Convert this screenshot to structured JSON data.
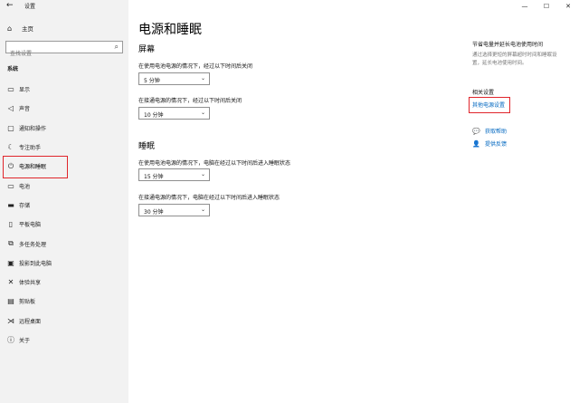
{
  "window": {
    "title": "设置",
    "controls": {
      "minimize": "—",
      "maximize": "☐",
      "close": "✕"
    }
  },
  "sidebar": {
    "home_label": "主页",
    "search_placeholder": "查找设置",
    "section": "系统",
    "items": [
      {
        "label": "显示",
        "icon": "monitor-icon"
      },
      {
        "label": "声音",
        "icon": "speaker-icon"
      },
      {
        "label": "通知和操作",
        "icon": "notification-icon"
      },
      {
        "label": "专注助手",
        "icon": "moon-icon"
      },
      {
        "label": "电源和睡眠",
        "icon": "power-icon"
      },
      {
        "label": "电池",
        "icon": "battery-icon"
      },
      {
        "label": "存储",
        "icon": "storage-icon"
      },
      {
        "label": "平板电脑",
        "icon": "tablet-icon"
      },
      {
        "label": "多任务处理",
        "icon": "multitask-icon"
      },
      {
        "label": "投影到此电脑",
        "icon": "projector-icon"
      },
      {
        "label": "体验共享",
        "icon": "share-icon"
      },
      {
        "label": "剪贴板",
        "icon": "clipboard-icon"
      },
      {
        "label": "远程桌面",
        "icon": "remote-desktop-icon"
      },
      {
        "label": "关于",
        "icon": "info-icon"
      }
    ]
  },
  "main": {
    "title": "电源和睡眠",
    "screen": {
      "heading": "屏幕",
      "battery_label": "在使用电池电源的情况下，经过以下时间后关闭",
      "battery_value": "5 分钟",
      "plugged_label": "在接通电源的情况下，经过以下时间后关闭",
      "plugged_value": "10 分钟"
    },
    "sleep": {
      "heading": "睡眠",
      "battery_label": "在使用电池电源的情况下，电脑在经过以下时间后进入睡眠状态",
      "battery_value": "15 分钟",
      "plugged_label": "在接通电源的情况下，电脑在经过以下时间后进入睡眠状态",
      "plugged_value": "30 分钟"
    }
  },
  "right": {
    "tip_title": "节省电量并延长电池使用时间",
    "tip_text_1": "通过选择更短的屏幕超时时间和睡眠设",
    "tip_text_2": "置，延长电池使用时间。",
    "related_title": "相关设置",
    "related_link": "其他电源设置",
    "help_link": "获取帮助",
    "feedback_link": "提供反馈"
  }
}
